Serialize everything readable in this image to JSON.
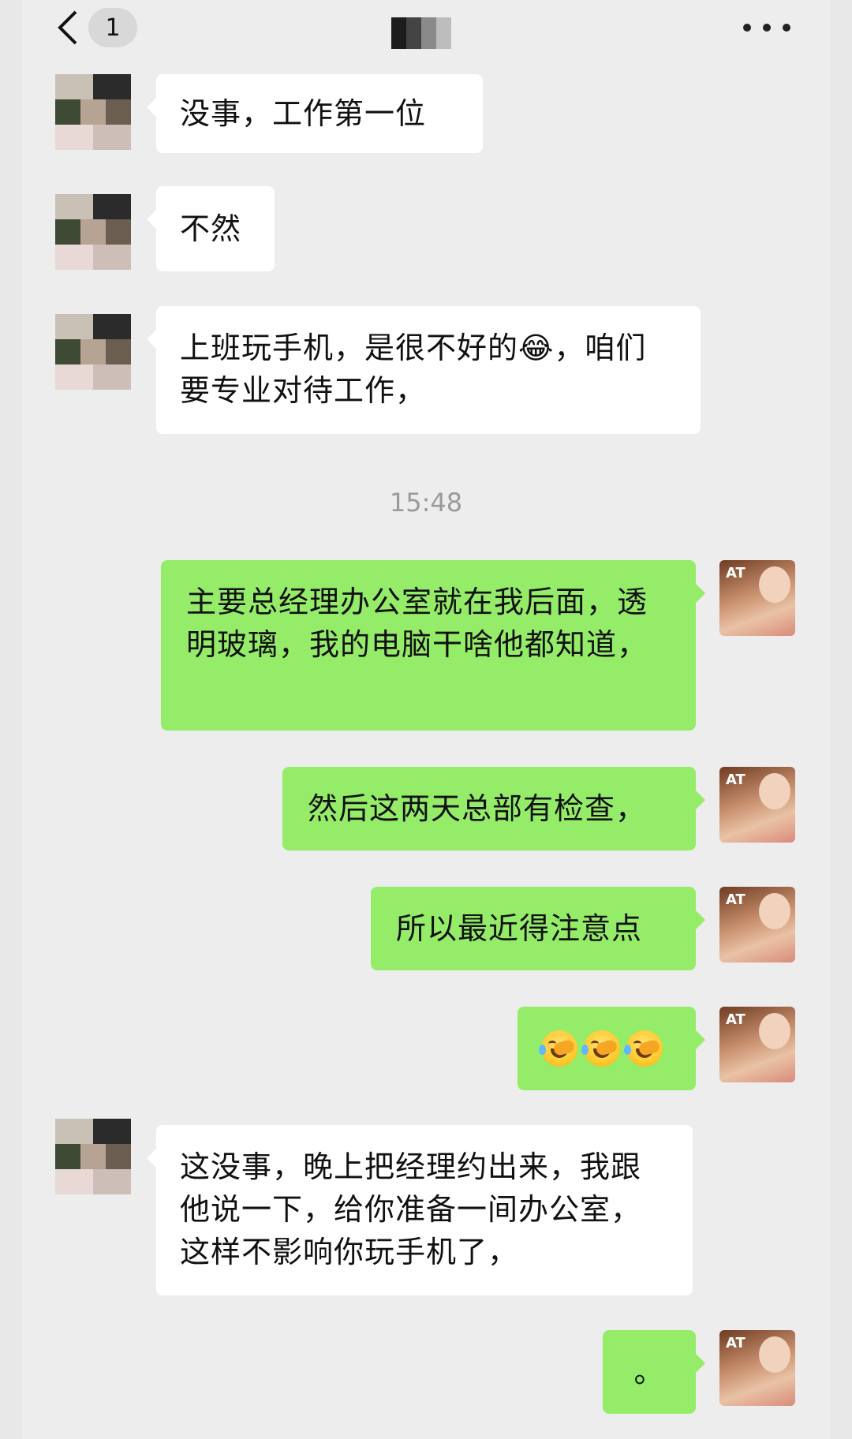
{
  "header": {
    "unread_count": "1",
    "back_icon": "chevron-left-icon",
    "more_icon": "more-dots-icon"
  },
  "messages": [
    {
      "side": "left",
      "text": "没事，工作第一位"
    },
    {
      "side": "left",
      "text": "不然"
    },
    {
      "side": "left",
      "text": "上班玩手机，是很不好的😂，咱们要专业对待工作，"
    },
    {
      "side": "right",
      "text": "主要总经理办公室就在我后面，透明玻璃，我的电脑干啥他都知道，"
    },
    {
      "side": "right",
      "text": "然后这两天总部有检查，"
    },
    {
      "side": "right",
      "text": "所以最近得注意点"
    },
    {
      "side": "right",
      "text": "🤦🤦🤦"
    },
    {
      "side": "left",
      "text": "这没事，晚上把经理约出来，我跟他说一下，给你准备一间办公室，这样不影响你玩手机了，"
    },
    {
      "side": "right",
      "text": "。"
    }
  ],
  "timestamp": "15:48",
  "colors": {
    "background": "#ededed",
    "left_bubble": "#ffffff",
    "right_bubble": "#95ec69",
    "timestamp_text": "#9a9a9a"
  }
}
